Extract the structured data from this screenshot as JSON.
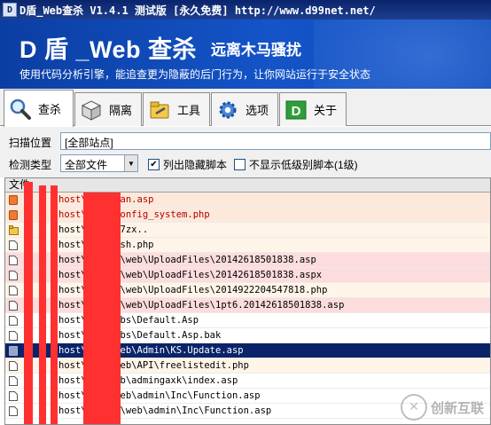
{
  "window": {
    "title": "D盾_Web查杀 V1.4.1 测试版 [永久免费] http://www.d99net.net/"
  },
  "banner": {
    "title": "D 盾 _Web 查杀",
    "subtitle": "远离木马骚扰",
    "description": "使用代码分析引擎，能追查更为隐蔽的后门行为，让你网站运行于安全状态"
  },
  "tabs": [
    {
      "label": "查杀",
      "icon": "magnifier-icon",
      "active": true
    },
    {
      "label": "隔离",
      "icon": "box-icon",
      "active": false
    },
    {
      "label": "工具",
      "icon": "folder-tools-icon",
      "active": false
    },
    {
      "label": "选项",
      "icon": "gear-icon",
      "active": false
    },
    {
      "label": "关于",
      "icon": "d-logo-icon",
      "active": false
    }
  ],
  "form": {
    "scan_location_label": "扫描位置",
    "scan_location_value": "[全部站点]",
    "detect_type_label": "检测类型",
    "detect_type_value": "全部文件",
    "checkbox_hidden_label": "列出隐藏脚本",
    "checkbox_hidden_checked": true,
    "checkbox_lowlevel_label": "不显示低级别脚本(1级)",
    "checkbox_lowlevel_checked": false
  },
  "list": {
    "column_header": "文件",
    "rows": [
      {
        "path": "host\\      web\\ban.asp",
        "color": "#b00000",
        "bg": "#fde9dc",
        "icon": "orange-file-icon"
      },
      {
        "path": "host\\      web\\config_system.php",
        "color": "#b00000",
        "bg": "#fde9dc",
        "icon": "orange-file-icon"
      },
      {
        "path": "host\\      web\\x7zx..",
        "color": "#000000",
        "bg": "#fff4e8",
        "icon": "folder-icon"
      },
      {
        "path": "host\\      web\\ysh.php",
        "color": "#000000",
        "bg": "#fff4e8",
        "icon": "file-icon"
      },
      {
        "path": "host\\      e1011\\web\\UploadFiles\\20142618501838.asp",
        "color": "#000000",
        "bg": "#fcdcdc",
        "icon": "file-icon"
      },
      {
        "path": "host\\      e1011\\web\\UploadFiles\\20142618501838.aspx",
        "color": "#000000",
        "bg": "#fcdcdc",
        "icon": "file-icon"
      },
      {
        "path": "host\\      e1011\\web\\UploadFiles\\2014922204547818.php",
        "color": "#000000",
        "bg": "#fff4e8",
        "icon": "file-icon"
      },
      {
        "path": "host\\      e1011\\web\\UploadFiles\\1pt6.20142618501838.asp",
        "color": "#000000",
        "bg": "#fcdcdc",
        "icon": "file-icon"
      },
      {
        "path": "host\\      web\\bbs\\Default.Asp",
        "color": "#000000",
        "bg": "#ffffff",
        "icon": "file-icon"
      },
      {
        "path": "host\\      web\\bbs\\Default.Asp.bak",
        "color": "#000000",
        "bg": "#ffffff",
        "icon": "file-icon"
      },
      {
        "path": "host\\      ao2\\web\\Admin\\KS.Update.asp",
        "color": "#ffffff",
        "bg": "#0a246a",
        "icon": "file-icon",
        "selected": true
      },
      {
        "path": "host\\      ao2\\web\\API\\freelistedit.php",
        "color": "#000000",
        "bg": "#fff4e8",
        "icon": "file-icon"
      },
      {
        "path": "host\\      66\\web\\admingaxk\\index.asp",
        "color": "#000000",
        "bg": "#ffffff",
        "icon": "file-icon"
      },
      {
        "path": "host\\      629\\web\\admin\\Inc\\Function.asp",
        "color": "#000000",
        "bg": "#ffffff",
        "icon": "file-icon"
      },
      {
        "path": "host\\      n1108\\web\\admin\\Inc\\Function.asp",
        "color": "#000000",
        "bg": "#ffffff",
        "icon": "file-icon"
      }
    ]
  },
  "watermark": {
    "text": "创新互联"
  }
}
